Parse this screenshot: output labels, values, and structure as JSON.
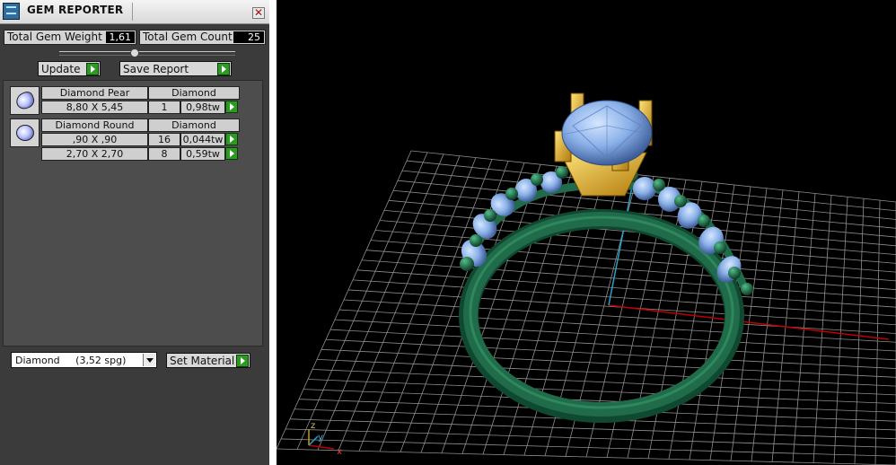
{
  "window": {
    "title": "GEM REPORTER",
    "close_glyph": "✕"
  },
  "stats": {
    "weight_label": "Total Gem Weight",
    "weight_value": "1,61",
    "count_label": "Total Gem Count",
    "count_value": "25"
  },
  "buttons": {
    "update": "Update",
    "save_report": "Save Report",
    "set_material": "Set Material"
  },
  "gems": [
    {
      "name": "Diamond Pear",
      "material": "Diamond",
      "rows": [
        {
          "size": "8,80 X 5,45",
          "qty": "1",
          "weight": "0,98tw"
        }
      ]
    },
    {
      "name": "Diamond Round",
      "material": "Diamond",
      "rows": [
        {
          "size": ",90 X ,90",
          "qty": "16",
          "weight": "0,044tw"
        },
        {
          "size": "2,70 X 2,70",
          "qty": "8",
          "weight": "0,59tw"
        }
      ]
    }
  ],
  "material_select": {
    "value": "Diamond     (3,52 spg)"
  },
  "axes": {
    "x": "x",
    "y": "y",
    "z": "z"
  },
  "colors": {
    "grid": "#9a9a9a",
    "metal_green": "#1f6b4a",
    "gold": "#d4a21c",
    "gem_blue": "#8ab0e8",
    "axis_red": "#c00000",
    "axis_blue": "#2aa0c8",
    "go_green": "#2e9a24"
  }
}
